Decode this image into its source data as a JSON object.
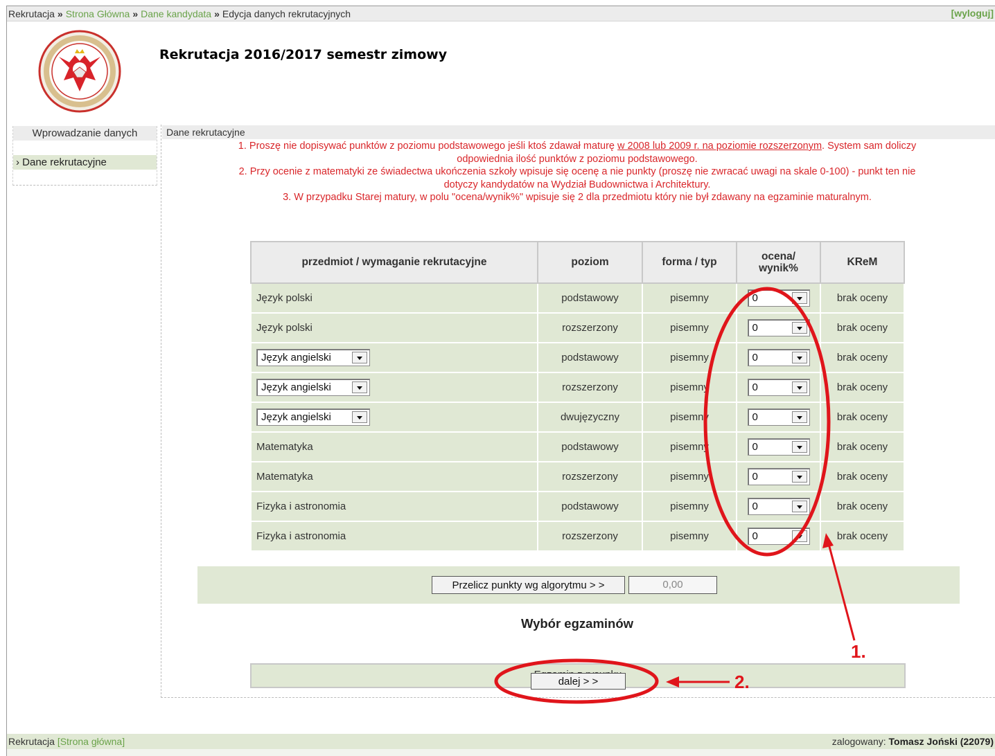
{
  "breadcrumb": {
    "root": "Rekrutacja",
    "link1": "Strona Główna",
    "link2": "Dane kandydata",
    "current": "Edycja danych rekrutacyjnych",
    "separator": "»",
    "logout": "[wyloguj]"
  },
  "header": {
    "title": "Rekrutacja 2016/2017 semestr zimowy"
  },
  "sidebar": {
    "heading": "Wprowadzanie danych",
    "items": [
      {
        "label": "› Dane rekrutacyjne"
      }
    ]
  },
  "main": {
    "heading": "Dane rekrutacyjne",
    "notes": {
      "n1_a": "1. Proszę nie dopisywać punktów z poziomu podstawowego jeśli ktoś zdawał maturę ",
      "n1_link": "w 2008 lub 2009 r. na poziomie rozszerzonym",
      "n1_b": ". System sam doliczy",
      "n1_c": "odpowiednia ilość punktów z poziomu podstawowego.",
      "n2_a": "2. Przy ocenie z matematyki ze świadectwa ukończenia szkoły wpisuje się ocenę a nie punkty (proszę nie zwracać uwagi na skale 0-100)  - punkt ten nie",
      "n2_b": "dotyczy kandydatów na Wydział Budownictwa i Architektury.",
      "n3": "3. W przypadku Starej matury, w polu \"ocena/wynik%\" wpisuje się 2 dla przedmiotu który nie był zdawany na egzaminie maturalnym."
    },
    "table": {
      "headers": [
        "przedmiot / wymaganie rekrutacyjne",
        "poziom",
        "forma / typ",
        "ocena/ wynik%",
        "KReM"
      ],
      "rows": [
        {
          "subject": "Język polski",
          "subject_select": false,
          "level": "podstawowy",
          "form": "pisemny",
          "grade": "0",
          "krem": "brak oceny"
        },
        {
          "subject": "Język polski",
          "subject_select": false,
          "level": "rozszerzony",
          "form": "pisemny",
          "grade": "0",
          "krem": "brak oceny"
        },
        {
          "subject": "Język angielski",
          "subject_select": true,
          "level": "podstawowy",
          "form": "pisemny",
          "grade": "0",
          "krem": "brak oceny"
        },
        {
          "subject": "Język angielski",
          "subject_select": true,
          "level": "rozszerzony",
          "form": "pisemny",
          "grade": "0",
          "krem": "brak oceny"
        },
        {
          "subject": "Język angielski",
          "subject_select": true,
          "level": "dwujęzyczny",
          "form": "pisemny",
          "grade": "0",
          "krem": "brak oceny"
        },
        {
          "subject": "Matematyka",
          "subject_select": false,
          "level": "podstawowy",
          "form": "pisemny",
          "grade": "0",
          "krem": "brak oceny"
        },
        {
          "subject": "Matematyka",
          "subject_select": false,
          "level": "rozszerzony",
          "form": "pisemny",
          "grade": "0",
          "krem": "brak oceny"
        },
        {
          "subject": "Fizyka i astronomia",
          "subject_select": false,
          "level": "podstawowy",
          "form": "pisemny",
          "grade": "0",
          "krem": "brak oceny"
        },
        {
          "subject": "Fizyka i astronomia",
          "subject_select": false,
          "level": "rozszerzony",
          "form": "pisemny",
          "grade": "0",
          "krem": "brak oceny"
        }
      ]
    },
    "calc_button": "Przelicz punkty wg algorytmu > >",
    "calc_result": "0,00",
    "exams_title": "Wybór egzaminów",
    "exam_item": "Egzamin z rysunku",
    "next_button": "dalej > >"
  },
  "footer": {
    "app": "Rekrutacja",
    "home_link": "[Strona główna]",
    "logged_label": "zalogowany: ",
    "user": "Tomasz Joński (22079)"
  },
  "annotations": {
    "label1": "1.",
    "label2": "2.",
    "color": "#e0151b"
  },
  "colors": {
    "link_green": "#6aa34a",
    "row_bg": "#e0e8d4",
    "note_red": "#d9262a"
  },
  "icons": {
    "dropdown": "chevron-down-icon",
    "logo": "university-emblem"
  }
}
